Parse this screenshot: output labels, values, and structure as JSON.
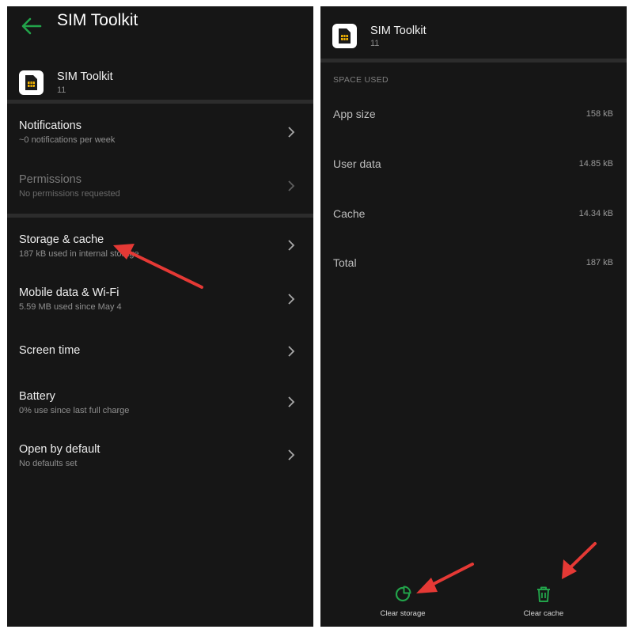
{
  "colors": {
    "accent": "#22a34a",
    "background": "#161616",
    "annotation_arrow": "#e53935"
  },
  "left_screen": {
    "title": "SIM Toolkit",
    "back_icon": "back-arrow-icon",
    "app": {
      "name": "SIM Toolkit",
      "version": "11",
      "icon": "sim-card-icon"
    },
    "items": [
      {
        "title": "Notifications",
        "subtitle": "~0 notifications per week",
        "enabled": true
      },
      {
        "title": "Permissions",
        "subtitle": "No permissions requested",
        "enabled": false
      },
      {
        "title": "Storage & cache",
        "subtitle": "187 kB used in internal storage",
        "enabled": true
      },
      {
        "title": "Mobile data & Wi-Fi",
        "subtitle": "5.59 MB used since May 4",
        "enabled": true
      },
      {
        "title": "Screen time",
        "subtitle": "",
        "enabled": true
      },
      {
        "title": "Battery",
        "subtitle": "0% use since last full charge",
        "enabled": true
      },
      {
        "title": "Open by default",
        "subtitle": "No defaults set",
        "enabled": true
      }
    ]
  },
  "right_screen": {
    "app": {
      "name": "SIM Toolkit",
      "version": "11",
      "icon": "sim-card-icon"
    },
    "section_label": "SPACE USED",
    "stats": [
      {
        "label": "App size",
        "value": "158 kB"
      },
      {
        "label": "User data",
        "value": "14.85 kB"
      },
      {
        "label": "Cache",
        "value": "14.34 kB"
      },
      {
        "label": "Total",
        "value": "187 kB"
      }
    ],
    "actions": [
      {
        "label": "Clear storage",
        "icon": "pie-chart-icon"
      },
      {
        "label": "Clear cache",
        "icon": "trash-icon"
      }
    ]
  }
}
